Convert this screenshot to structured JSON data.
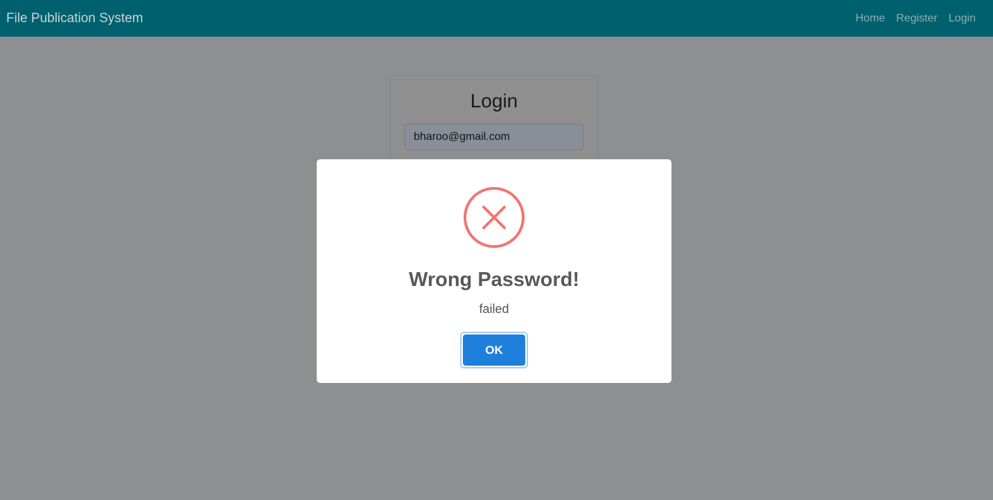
{
  "navbar": {
    "brand": "File Publication System",
    "links": [
      {
        "label": "Home"
      },
      {
        "label": "Register"
      },
      {
        "label": "Login"
      }
    ],
    "color": "#00606d"
  },
  "login": {
    "title": "Login",
    "email_value": "bharoo@gmail.com"
  },
  "modal": {
    "icon": "error-x-icon",
    "icon_color": "#f27474",
    "title": "Wrong Password!",
    "text": "failed",
    "ok_label": "OK",
    "ok_color": "#1f7fdc"
  }
}
